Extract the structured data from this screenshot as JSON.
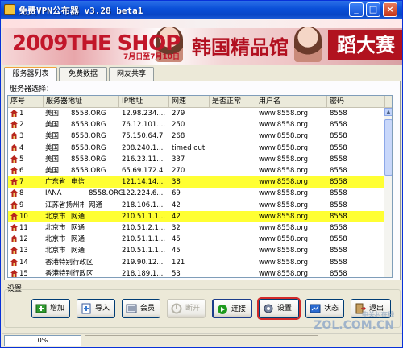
{
  "window": {
    "title": "免费VPN公布器 v3.28 beta1",
    "controls": {
      "minimize": "_",
      "maximize": "□",
      "close": "×"
    }
  },
  "banner": {
    "headline": "2009THE SHOP",
    "headline_cn": "韩国精品馆",
    "badge": "蹈大赛",
    "date_text": "7月日至7月10日"
  },
  "tabs": [
    {
      "label": "服务器列表",
      "active": true
    },
    {
      "label": "免费数据",
      "active": false
    },
    {
      "label": "网友共享",
      "active": false
    }
  ],
  "server_list": {
    "group_label": "服务器选择：",
    "columns": [
      "序号",
      "服务器地址",
      "IP地址",
      "网速",
      "是否正常",
      "用户名",
      "密码"
    ],
    "rows": [
      {
        "no": "1",
        "region": "美国",
        "host": "8558.ORG",
        "ip": "12.98.234....",
        "speed": "279",
        "ok": "",
        "user": "www.8558.org",
        "pass": "8558",
        "highlight": false
      },
      {
        "no": "2",
        "region": "美国",
        "host": "8558.ORG",
        "ip": "76.12.101....",
        "speed": "250",
        "ok": "",
        "user": "www.8558.org",
        "pass": "8558",
        "highlight": false
      },
      {
        "no": "3",
        "region": "美国",
        "host": "8558.ORG",
        "ip": "75.150.64.7",
        "speed": "268",
        "ok": "",
        "user": "www.8558.org",
        "pass": "8558",
        "highlight": false
      },
      {
        "no": "4",
        "region": "美国",
        "host": "8558.ORG",
        "ip": "208.240.1...",
        "speed": "timed out",
        "ok": "",
        "user": "www.8558.org",
        "pass": "8558",
        "highlight": false
      },
      {
        "no": "5",
        "region": "美国",
        "host": "8558.ORG",
        "ip": "216.23.11...",
        "speed": "337",
        "ok": "",
        "user": "www.8558.org",
        "pass": "8558",
        "highlight": false
      },
      {
        "no": "6",
        "region": "美国",
        "host": "8558.ORG",
        "ip": "65.69.172.4",
        "speed": "270",
        "ok": "",
        "user": "www.8558.org",
        "pass": "8558",
        "highlight": false
      },
      {
        "no": "7",
        "region": "广东省",
        "host": "电信",
        "ip": "121.14.14...",
        "speed": "38",
        "ok": "",
        "user": "www.8558.org",
        "pass": "8558",
        "highlight": true
      },
      {
        "no": "8",
        "region": "IANA",
        "host": "8558.ORG",
        "ip": "122.224.6...",
        "speed": "69",
        "ok": "",
        "user": "www.8558.org",
        "pass": "8558",
        "highlight": false
      },
      {
        "no": "9",
        "region": "江苏省扬州市",
        "host": "网通",
        "ip": "218.106.1...",
        "speed": "42",
        "ok": "",
        "user": "www.8558.org",
        "pass": "8558",
        "highlight": false
      },
      {
        "no": "10",
        "region": "北京市",
        "host": "网通",
        "ip": "210.51.1.1...",
        "speed": "42",
        "ok": "",
        "user": "www.8558.org",
        "pass": "8558",
        "highlight": true
      },
      {
        "no": "11",
        "region": "北京市",
        "host": "网通",
        "ip": "210.51.2.1...",
        "speed": "32",
        "ok": "",
        "user": "www.8558.org",
        "pass": "8558",
        "highlight": false
      },
      {
        "no": "12",
        "region": "北京市",
        "host": "网通",
        "ip": "210.51.1.1...",
        "speed": "45",
        "ok": "",
        "user": "www.8558.org",
        "pass": "8558",
        "highlight": false
      },
      {
        "no": "13",
        "region": "北京市",
        "host": "网通",
        "ip": "210.51.1.1...",
        "speed": "45",
        "ok": "",
        "user": "www.8558.org",
        "pass": "8558",
        "highlight": false
      },
      {
        "no": "14",
        "region": "香港特别行政区",
        "host": "",
        "ip": "219.90.12...",
        "speed": "121",
        "ok": "",
        "user": "www.8558.org",
        "pass": "8558",
        "highlight": false
      },
      {
        "no": "15",
        "region": "香港特别行政区",
        "host": "",
        "ip": "218.189.1...",
        "speed": "53",
        "ok": "",
        "user": "www.8558.org",
        "pass": "8558",
        "highlight": false
      }
    ]
  },
  "settings": {
    "label": "设置",
    "buttons": [
      {
        "label": "增加",
        "icon": "add-icon",
        "state": "normal"
      },
      {
        "label": "导入",
        "icon": "import-icon",
        "state": "normal"
      },
      {
        "label": "会员",
        "icon": "member-icon",
        "state": "normal"
      },
      {
        "label": "断开",
        "icon": "disconnect-icon",
        "state": "disabled"
      },
      {
        "label": "连接",
        "icon": "connect-icon",
        "state": "default"
      },
      {
        "label": "设置",
        "icon": "settings-icon",
        "state": "outlined"
      },
      {
        "label": "状态",
        "icon": "status-icon",
        "state": "normal"
      },
      {
        "label": "退出",
        "icon": "exit-icon",
        "state": "normal"
      }
    ]
  },
  "statusbar": {
    "progress_text": "0%",
    "progress_value": 0
  },
  "watermark": {
    "text": "ZOL.COM.CN",
    "text_cn": "中关村在线"
  },
  "colors": {
    "highlight": "#ffff33",
    "titlebar": "#0a4fd8",
    "accent_red": "#d22a2a"
  }
}
